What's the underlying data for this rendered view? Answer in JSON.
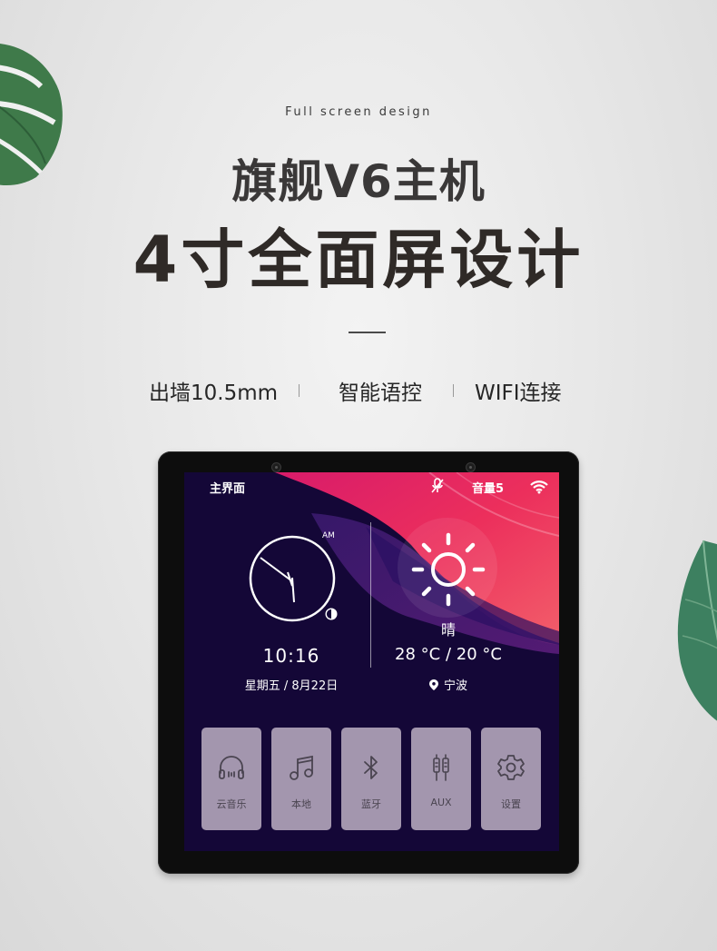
{
  "header": {
    "subtitle_en": "Full screen design",
    "headline_1": "旗舰V6主机",
    "headline_2": "4寸全面屏设计"
  },
  "features": [
    {
      "label": "出墙10.5mm"
    },
    {
      "label": "智能语控"
    },
    {
      "label": "WIFI连接"
    }
  ],
  "device": {
    "status_bar": {
      "title": "主界面",
      "mic_icon": "mic-off-icon",
      "volume_label": "音量5",
      "wifi_icon": "wifi-icon"
    },
    "clock": {
      "period": "AM",
      "time": "10:16",
      "date": "星期五 / 8月22日",
      "theme_icon": "half-moon-icon"
    },
    "weather": {
      "icon": "sun-icon",
      "condition": "晴",
      "temperature": "28 °C / 20 °C",
      "location_icon": "location-pin-icon",
      "location": "宁波"
    },
    "apps": [
      {
        "label": "云音乐",
        "icon": "headphones-icon"
      },
      {
        "label": "本地",
        "icon": "music-note-icon"
      },
      {
        "label": "蓝牙",
        "icon": "bluetooth-icon"
      },
      {
        "label": "AUX",
        "icon": "aux-cable-icon"
      },
      {
        "label": "设置",
        "icon": "gear-icon"
      }
    ],
    "colors": {
      "screen_bg": "#140737",
      "tile_bg": "#a396ae",
      "accent_pink": "#e6285e"
    }
  }
}
